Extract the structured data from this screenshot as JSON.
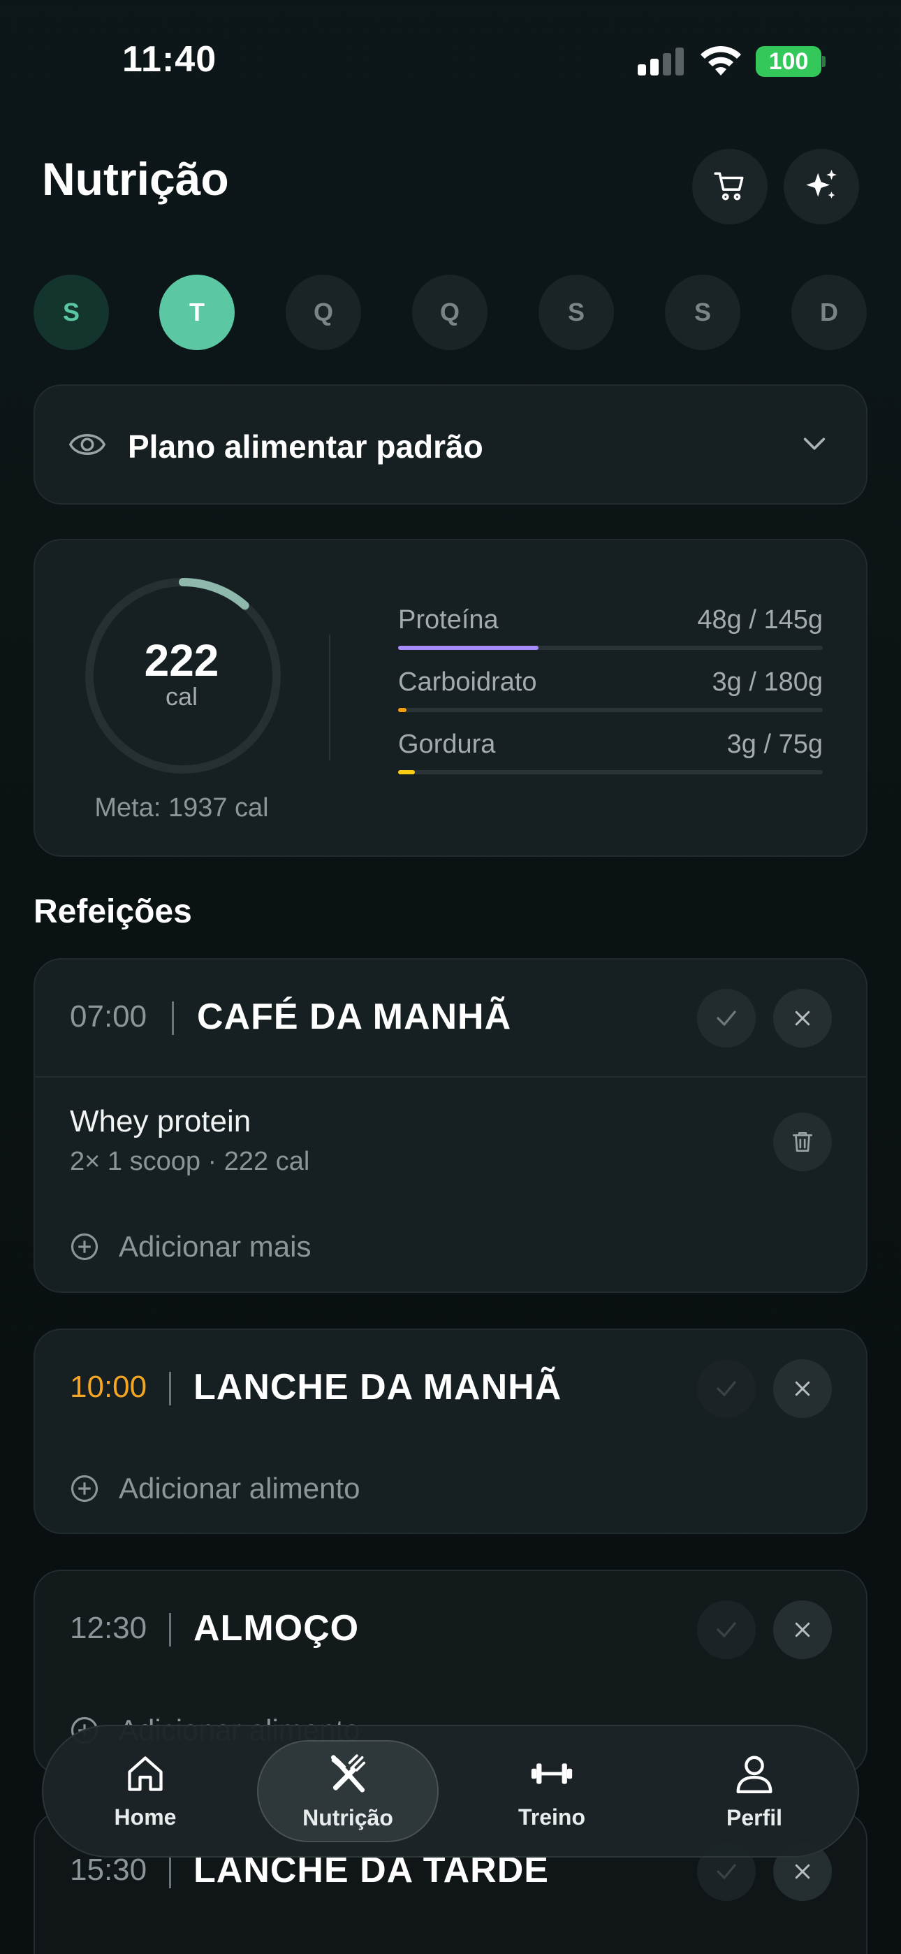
{
  "status_bar": {
    "time": "11:40",
    "battery": "100"
  },
  "header": {
    "title": "Nutrição",
    "cart_icon": "cart-icon",
    "sparkle_icon": "sparkles-icon"
  },
  "days": [
    {
      "label": "S",
      "state": "past"
    },
    {
      "label": "T",
      "state": "active"
    },
    {
      "label": "Q",
      "state": "future"
    },
    {
      "label": "Q",
      "state": "future"
    },
    {
      "label": "S",
      "state": "future"
    },
    {
      "label": "S",
      "state": "future"
    },
    {
      "label": "D",
      "state": "future"
    }
  ],
  "plan": {
    "label": "Plano alimentar padrão"
  },
  "summary": {
    "calories": "222",
    "calories_unit": "cal",
    "goal": "Meta: 1937 cal",
    "progress_fraction": 0.115,
    "macros": [
      {
        "name": "Proteína",
        "value": "48g / 145g",
        "fraction": 0.33,
        "color": "#a78bfa"
      },
      {
        "name": "Carboidrato",
        "value": "3g / 180g",
        "fraction": 0.017,
        "color": "#f59e0b"
      },
      {
        "name": "Gordura",
        "value": "3g / 75g",
        "fraction": 0.04,
        "color": "#facc15"
      }
    ]
  },
  "meals_title": "Refeições",
  "meals": [
    {
      "time": "07:00",
      "name": "CAFÉ DA MANHÃ",
      "item_name": "Whey protein",
      "item_detail": "2× 1 scoop · 222 cal",
      "add_label": "Adicionar mais"
    },
    {
      "time": "10:00",
      "name": "LANCHE DA MANHÃ",
      "time_color": "#f5a524",
      "add_label": "Adicionar alimento"
    },
    {
      "time": "12:30",
      "name": "ALMOÇO",
      "add_label": "Adicionar alimento"
    },
    {
      "time": "15:30",
      "name": "LANCHE DA TARDE"
    }
  ],
  "nav": [
    {
      "label": "Home",
      "icon": "home-icon"
    },
    {
      "label": "Nutrição",
      "icon": "fork-knife-icon",
      "active": true
    },
    {
      "label": "Treino",
      "icon": "dumbbell-icon"
    },
    {
      "label": "Perfil",
      "icon": "person-icon"
    }
  ]
}
